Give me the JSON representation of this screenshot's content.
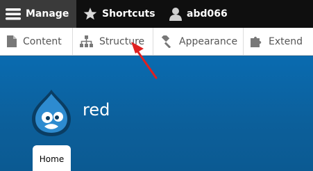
{
  "toolbar": {
    "manage_label": "Manage",
    "shortcuts_label": "Shortcuts",
    "user_label": "abd066",
    "manage_icon": "hamburger-menu-icon",
    "shortcuts_icon": "star-icon",
    "user_icon": "user-icon"
  },
  "tray": {
    "items": [
      {
        "label": "Content",
        "icon": "document-icon"
      },
      {
        "label": "Structure",
        "icon": "sitemap-icon"
      },
      {
        "label": "Appearance",
        "icon": "paintbrush-icon"
      },
      {
        "label": "Extend",
        "icon": "puzzle-icon"
      }
    ]
  },
  "site": {
    "name": "red",
    "logo": "drupal-drop-logo",
    "nav_home": "Home"
  },
  "annotation": {
    "type": "red-arrow",
    "color": "#e02020"
  }
}
